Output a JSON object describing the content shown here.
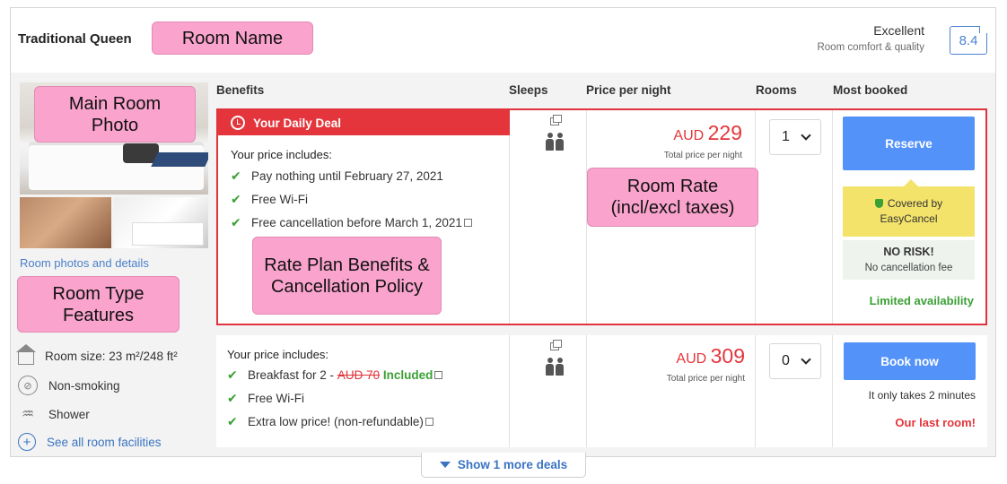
{
  "room": {
    "name": "Traditional Queen",
    "photos_link": "Room photos and details",
    "features": [
      {
        "icon": "room-size-icon",
        "label": "Room size: 23 m²/248 ft²"
      },
      {
        "icon": "no-smoking-icon",
        "label": "Non-smoking"
      },
      {
        "icon": "shower-icon",
        "label": "Shower"
      }
    ],
    "see_all": "See all room facilities"
  },
  "rating": {
    "label": "Excellent",
    "sublabel": "Room comfort & quality",
    "score": "8.4"
  },
  "headers": {
    "benefits": "Benefits",
    "sleeps": "Sleeps",
    "price": "Price per night",
    "rooms": "Rooms",
    "most_booked": "Most booked"
  },
  "deals": [
    {
      "banner": "Your Daily Deal",
      "includes_label": "Your price includes:",
      "benefits": [
        "Pay nothing until February 27, 2021",
        "Free Wi-Fi",
        "Free cancellation before March 1, 2021"
      ],
      "currency": "AUD",
      "price": "229",
      "price_note": "Total price per night",
      "rooms_selected": "1",
      "button": "Reserve",
      "easycancel_line1": "Covered by",
      "easycancel_line2": "EasyCancel",
      "norisk_title": "NO RISK!",
      "norisk_sub": "No cancellation fee",
      "availability": "Limited availability"
    },
    {
      "includes_label": "Your price includes:",
      "breakfast_prefix": "Breakfast for 2 -",
      "breakfast_old_price": "AUD 70",
      "breakfast_included": "Included",
      "benefits": [
        "Free Wi-Fi",
        "Extra low price! (non-refundable)"
      ],
      "currency": "AUD",
      "price": "309",
      "price_note": "Total price per night",
      "rooms_selected": "0",
      "button": "Book now",
      "takes": "It only takes 2 minutes",
      "last_room": "Our last room!"
    }
  ],
  "show_more": "Show 1 more deals",
  "annotations": {
    "room_name": "Room Name",
    "main_photo": "Main Room Photo",
    "room_type_features": "Room Type Features",
    "rate_plan": "Rate Plan Benefits & Cancellation Policy",
    "room_rate": "Room Rate (incl/excl taxes)"
  },
  "colors": {
    "accent_red": "#e3353b",
    "button_blue": "#5392f9",
    "link_blue": "#3a74c2",
    "success_green": "#3aa035",
    "callout_pink": "#f9a3cd",
    "easycancel_yellow": "#f3e36b"
  }
}
